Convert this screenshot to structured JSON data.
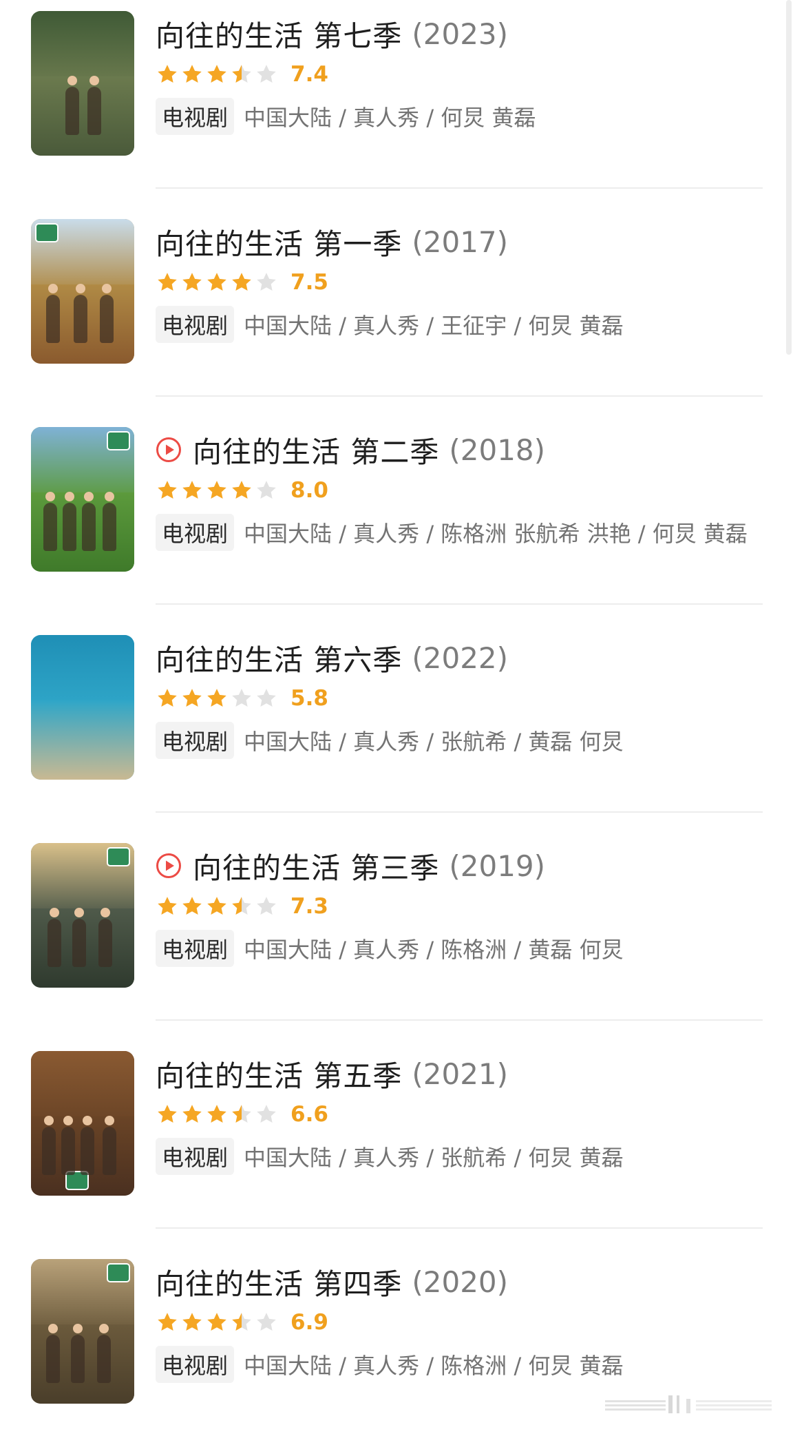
{
  "items": [
    {
      "title": "向往的生活 第七季",
      "year": "(2023)",
      "has_play": false,
      "rating": 7.4,
      "score": "7.4",
      "tag": "电视剧",
      "meta": "中国大陆 / 真人秀 / 何炅 黄磊",
      "poster_colors": [
        "#3f5a36",
        "#6b7a4e",
        "#4a5a3a"
      ]
    },
    {
      "title": "向往的生活 第一季",
      "year": "(2017)",
      "has_play": false,
      "rating": 7.5,
      "score": "7.5",
      "tag": "电视剧",
      "meta": "中国大陆 / 真人秀 / 王征宇 / 何炅 黄磊",
      "poster_colors": [
        "#c9dcea",
        "#b08a45",
        "#8a5a2e"
      ]
    },
    {
      "title": "向往的生活 第二季",
      "year": "(2018)",
      "has_play": true,
      "rating": 8.0,
      "score": "8.0",
      "tag": "电视剧",
      "meta": "中国大陆 / 真人秀 / 陈格洲 张航希 洪艳 / 何炅 黄磊",
      "poster_colors": [
        "#7fb2d6",
        "#5c9a3c",
        "#3f7a2a"
      ]
    },
    {
      "title": "向往的生活 第六季",
      "year": "(2022)",
      "has_play": false,
      "rating": 5.8,
      "score": "5.8",
      "tag": "电视剧",
      "meta": "中国大陆 / 真人秀 / 张航希 / 黄磊 何炅",
      "poster_colors": [
        "#1f8fb6",
        "#2fa6c8",
        "#c9b992"
      ]
    },
    {
      "title": "向往的生活 第三季",
      "year": "(2019)",
      "has_play": true,
      "rating": 7.3,
      "score": "7.3",
      "tag": "电视剧",
      "meta": "中国大陆 / 真人秀 / 陈格洲 / 黄磊 何炅",
      "poster_colors": [
        "#d9c08a",
        "#4f5a4a",
        "#2f3a2e"
      ]
    },
    {
      "title": "向往的生活 第五季",
      "year": "(2021)",
      "has_play": false,
      "rating": 6.6,
      "score": "6.6",
      "tag": "电视剧",
      "meta": "中国大陆 / 真人秀 / 张航希 / 何炅 黄磊",
      "poster_colors": [
        "#8a5a32",
        "#6a4426",
        "#4a3020"
      ]
    },
    {
      "title": "向往的生活 第四季",
      "year": "(2020)",
      "has_play": false,
      "rating": 6.9,
      "score": "6.9",
      "tag": "电视剧",
      "meta": "中国大陆 / 真人秀 / 陈格洲 / 何炅 黄磊",
      "poster_colors": [
        "#b9a27a",
        "#6b5a3c",
        "#4a3e2a"
      ]
    }
  ],
  "colors": {
    "star_filled": "#f5a623",
    "star_empty": "#e1e1e1",
    "play_red": "#ec4b45"
  }
}
